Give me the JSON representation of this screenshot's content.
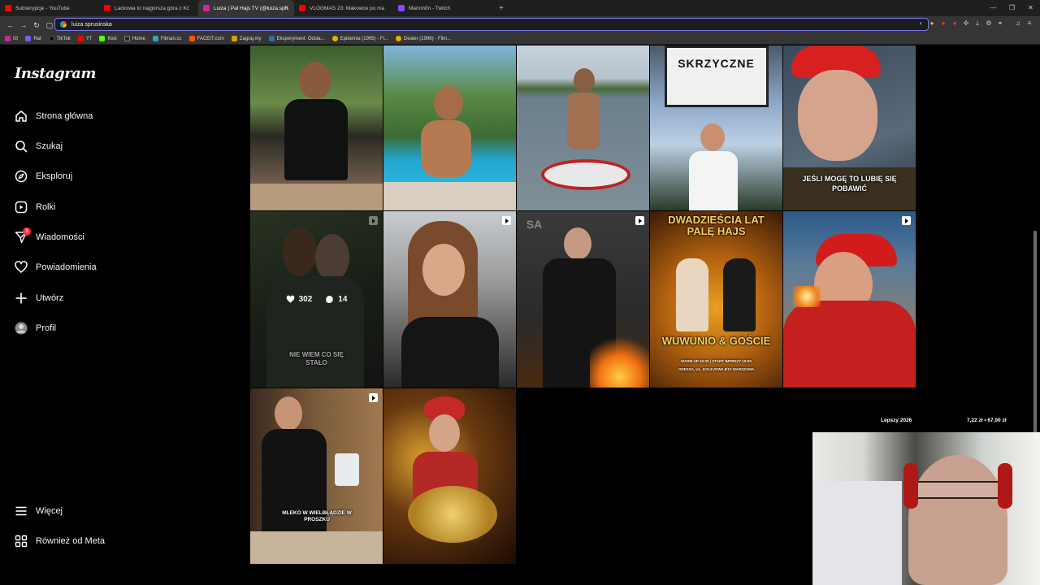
{
  "tabs": [
    {
      "label": "Subskrypcje - YouTube",
      "color": "#ff0000"
    },
    {
      "label": "Lackowa to najgorsza góra z KGPI | D",
      "color": "#ff0000"
    },
    {
      "label": "Luiza | Pal Hajs TV (@luiza.sprusi...",
      "color": "#d6249f",
      "active": true
    },
    {
      "label": "VLOGMAS 23: Makowce po makówk...",
      "color": "#ff0000"
    },
    {
      "label": "Mamm0n - Twitch",
      "color": "#9146ff"
    }
  ],
  "address": {
    "url": "luiza sprusinska"
  },
  "bookmarks": [
    {
      "label": "IG",
      "color": "#d6249f"
    },
    {
      "label": "Rat",
      "color": "#7a5cff"
    },
    {
      "label": "TikTok",
      "color": "#111111"
    },
    {
      "label": "YT",
      "color": "#ff0000"
    },
    {
      "label": "Kick",
      "color": "#53fc18"
    },
    {
      "label": "Home",
      "color": "#222222"
    },
    {
      "label": "Filman.cc",
      "color": "#3aa0c8"
    },
    {
      "label": "FACEIT.com",
      "color": "#ff5500"
    },
    {
      "label": "Zagraj.my",
      "color": "#d4a017"
    },
    {
      "label": "Eksperyment: Odsła...",
      "color": "#2f6ea8"
    },
    {
      "label": "Epidemia (1995) - Fi...",
      "color": "#e3b400"
    },
    {
      "label": "Dealer (1996) - Film...",
      "color": "#e3b400"
    }
  ],
  "sidebar": {
    "logo": "Instagram",
    "items": [
      {
        "label": "Strona główna",
        "icon": "home-icon"
      },
      {
        "label": "Szukaj",
        "icon": "search-icon"
      },
      {
        "label": "Eksploruj",
        "icon": "compass-icon"
      },
      {
        "label": "Rolki",
        "icon": "reels-icon"
      },
      {
        "label": "Wiadomości",
        "icon": "messenger-icon",
        "badge": "1"
      },
      {
        "label": "Powiadomienia",
        "icon": "heart-icon"
      },
      {
        "label": "Utwórz",
        "icon": "plus-icon"
      },
      {
        "label": "Profil",
        "icon": "avatar"
      }
    ],
    "bottom": [
      {
        "label": "Więcej",
        "icon": "menu-icon"
      },
      {
        "label": "Również od Meta",
        "icon": "meta-icon"
      }
    ]
  },
  "posts": [
    {
      "caption": "",
      "reel": false
    },
    {
      "caption": "",
      "reel": false
    },
    {
      "caption": "",
      "reel": false
    },
    {
      "caption": "SKRZYCZNE",
      "reel": false
    },
    {
      "caption": "JEŚLI MOGĘ TO LUBIĘ SIĘ POBAWIĆ",
      "reel": false
    },
    {
      "caption": "NIE WIEM CO SIĘ STAŁO",
      "reel": true,
      "likes": "302",
      "comments": "14",
      "hovered": true
    },
    {
      "caption": "",
      "reel": true
    },
    {
      "caption": "SA",
      "reel": true
    },
    {
      "caption": "DWADZIEŚCIA LAT PALĘ HAJS",
      "caption2": "WUWUNIO & GOŚCIE",
      "caption3": "WARM UP 15:00 | START IMPREZY 19:00",
      "caption4": "ODESSA, UL. KOLEJOWA 8/10 WARSZAWA",
      "reel": false
    },
    {
      "caption": "",
      "reel": true
    },
    {
      "caption": "MLEKO W WIELBŁĄDZIE W PROSZKU",
      "reel": true
    },
    {
      "caption": "",
      "reel": false
    }
  ],
  "stream": {
    "goal_label": "Lepszy 2026",
    "goal_amount": "7,22 zł • 67,00 zł"
  }
}
